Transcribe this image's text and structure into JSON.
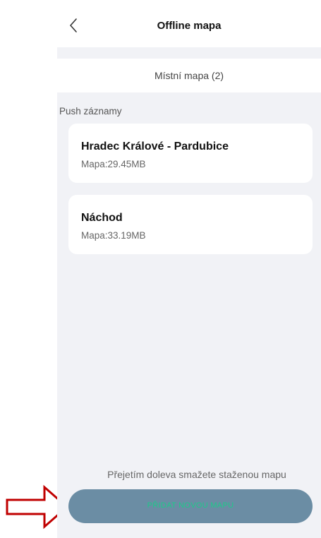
{
  "header": {
    "title": "Offline mapa",
    "back_icon": "chevron-left-icon"
  },
  "tab": {
    "label": "Místní mapa (2)"
  },
  "section": {
    "label": "Push záznamy"
  },
  "maps": [
    {
      "name": "Hradec Králové - Pardubice",
      "size": "Mapa:29.45MB"
    },
    {
      "name": "Náchod",
      "size": "Mapa:33.19MB"
    }
  ],
  "footer": {
    "hint": "Přejetím doleva smažete staženou mapu",
    "add_button_label": "PŘIDAT NOVOU MAPU"
  },
  "colors": {
    "background": "#f1f2f6",
    "button": "#6b8da4",
    "button_text": "#1ec98a",
    "arrow": "#c00000"
  }
}
